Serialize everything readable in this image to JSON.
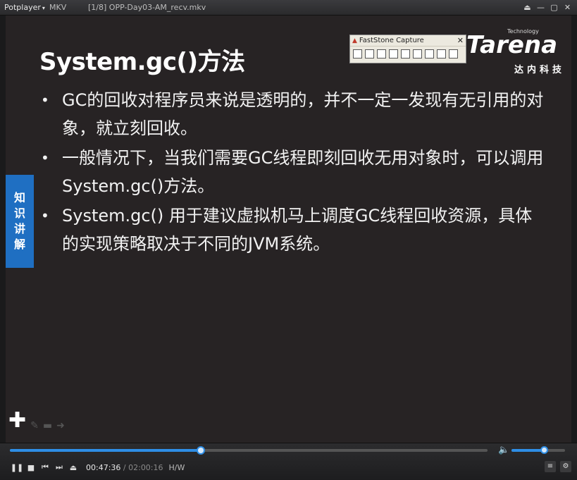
{
  "titlebar": {
    "app_name": "Potplayer",
    "caret": "▾",
    "format": "MKV",
    "file_title": "[1/8] OPP-Day03-AM_recv.mkv",
    "window_controls": [
      "⏏",
      "—",
      "▢",
      "✕"
    ]
  },
  "slide": {
    "title": "System.gc()方法",
    "bullets": [
      "GC的回收对程序员来说是透明的，并不一定一发现有无引用的对象，就立刻回收。",
      "一般情况下，当我们需要GC线程即刻回收无用对象时，可以调用 System.gc()方法。",
      "System.gc() 用于建议虚拟机马上调度GC线程回收资源，具体的实现策略取决于不同的JVM系统。"
    ],
    "bullet_char": "•",
    "side_tab": [
      "知",
      "识",
      "讲",
      "解"
    ]
  },
  "logo": {
    "small": "Technology",
    "brand": "Tarena",
    "chinese": "达内科技"
  },
  "faststone": {
    "title": "FastStone Capture",
    "close": "✕"
  },
  "overlay": {
    "plus": "✚"
  },
  "controls": {
    "current_time": "00:47:36",
    "separator": " / ",
    "total_time": "02:00:16",
    "hw_label": "H/W",
    "progress": 0.4,
    "volume": 0.6,
    "buttons": [
      "❚❚",
      "■",
      "⏮",
      "⏭",
      "⏏"
    ],
    "right_buttons": [
      "≡",
      "⚙"
    ]
  },
  "colors": {
    "accent": "#2e8ee6",
    "side_tab": "#1f6fc2",
    "slide_bg": "#272324"
  }
}
